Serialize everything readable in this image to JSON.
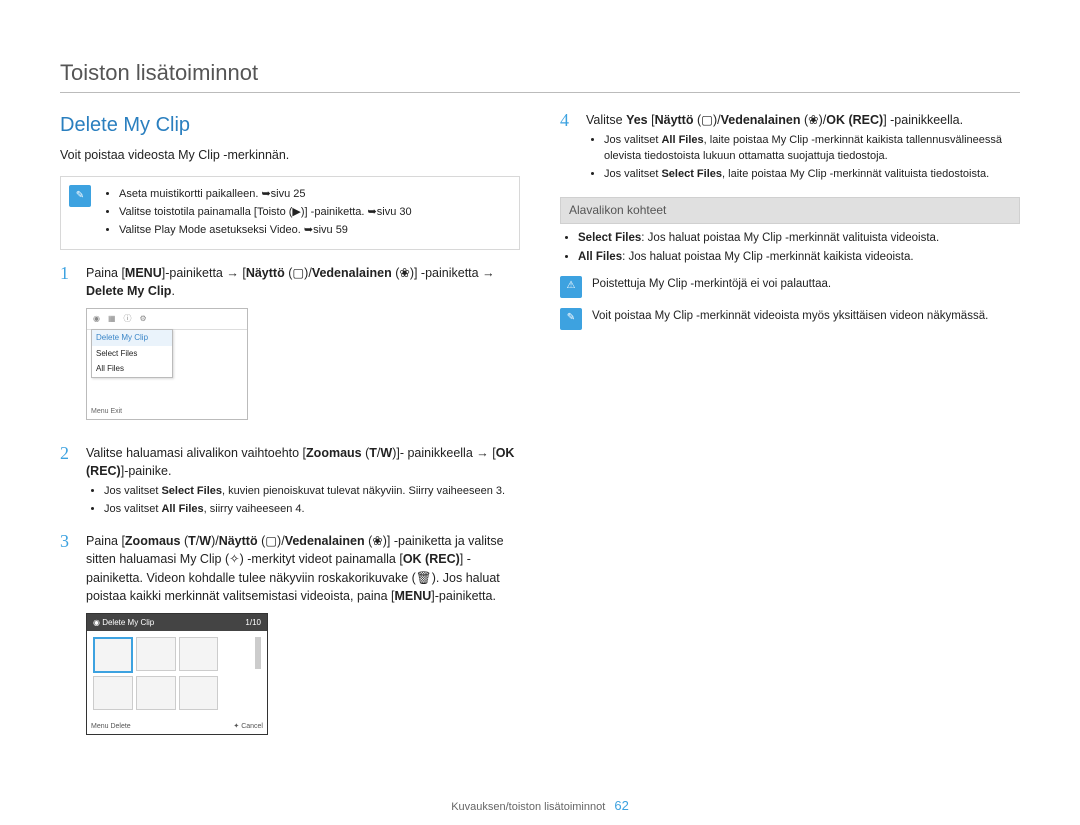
{
  "chapter_title": "Toiston lisätoiminnot",
  "section_title": "Delete My Clip",
  "intro": "Voit poistaa videosta My Clip -merkinnän.",
  "prereq_note": {
    "icon": "note-icon",
    "items": [
      "Aseta muistikortti paikalleen. ➥sivu 25",
      "Valitse toistotila painamalla [Toisto (▶)] -painiketta. ➥sivu 30",
      "Valitse Play Mode asetukseksi Video. ➥sivu 59"
    ]
  },
  "steps": [
    {
      "num": "1",
      "body_html": "Paina [<b>MENU</b>]-painiketta → [<b>Näyttö</b> (▢)/<b>Vedenalainen</b> (❀)] -painiketta → <b>Delete My Clip</b>.",
      "mock": "mock1"
    },
    {
      "num": "2",
      "body_html": "Valitse haluamasi alivalikon vaihtoehto [<b>Zoomaus</b> (<b>T</b>/<b>W</b>)]- painikkeella → [<b>OK (REC)</b>]-painike.",
      "bullets": [
        "Jos valitset <b>Select Files</b>, kuvien pienoiskuvat tulevat näkyviin. Siirry vaiheeseen 3.",
        "Jos valitset <b>All Files</b>, siirry vaiheeseen 4."
      ]
    },
    {
      "num": "3",
      "body_html": "Paina [<b>Zoomaus</b> (<b>T</b>/<b>W</b>)/<b>Näyttö</b> (▢)/<b>Vedenalainen</b> (❀)] -painiketta ja valitse sitten haluamasi My Clip (✧) -merkityt videot painamalla [<b>OK (REC)</b>] -painiketta. Videon kohdalle tulee näkyviin roskakorikuvake (🗑). Jos haluat poistaa kaikki merkinnät valitsemistasi videoista, paina [<b>MENU</b>]-painiketta.",
      "mock": "mock2"
    },
    {
      "num": "4",
      "body_html": "Valitse <b>Yes</b> [<b>Näyttö</b> (▢)/<b>Vedenalainen</b> (❀)/<b>OK (REC)</b>] -painikkeella.",
      "bullets": [
        "Jos valitset <b>All Files</b>, laite poistaa My Clip -merkinnät kaikista tallennusvälineessä olevista tiedostoista lukuun ottamatta suojattuja tiedostoja.",
        "Jos valitset <b>Select Files</b>, laite poistaa My Clip -merkinnät valituista tiedostoista."
      ]
    }
  ],
  "submenu_header": "Alavalikon kohteet",
  "submenu_items": [
    "<b>Select Files</b>: Jos haluat poistaa My Clip -merkinnät valituista videoista.",
    "<b>All Files</b>: Jos haluat poistaa My Clip -merkinnät kaikista videoista."
  ],
  "warn_note": "Poistettuja My Clip -merkintöjä ei voi palauttaa.",
  "info_note": "Voit poistaa My Clip -merkinnät videoista myös yksittäisen videon näkymässä.",
  "mock1": {
    "title": "Delete My Clip",
    "item1": "Select Files",
    "item2": "All Files",
    "exit": "Menu  Exit"
  },
  "mock2": {
    "title": "Delete My Clip",
    "counter": "1/10",
    "left": "Menu  Delete",
    "right": "✦ Cancel"
  },
  "footer_text": "Kuvauksen/toiston lisätoiminnot",
  "page_number": "62"
}
